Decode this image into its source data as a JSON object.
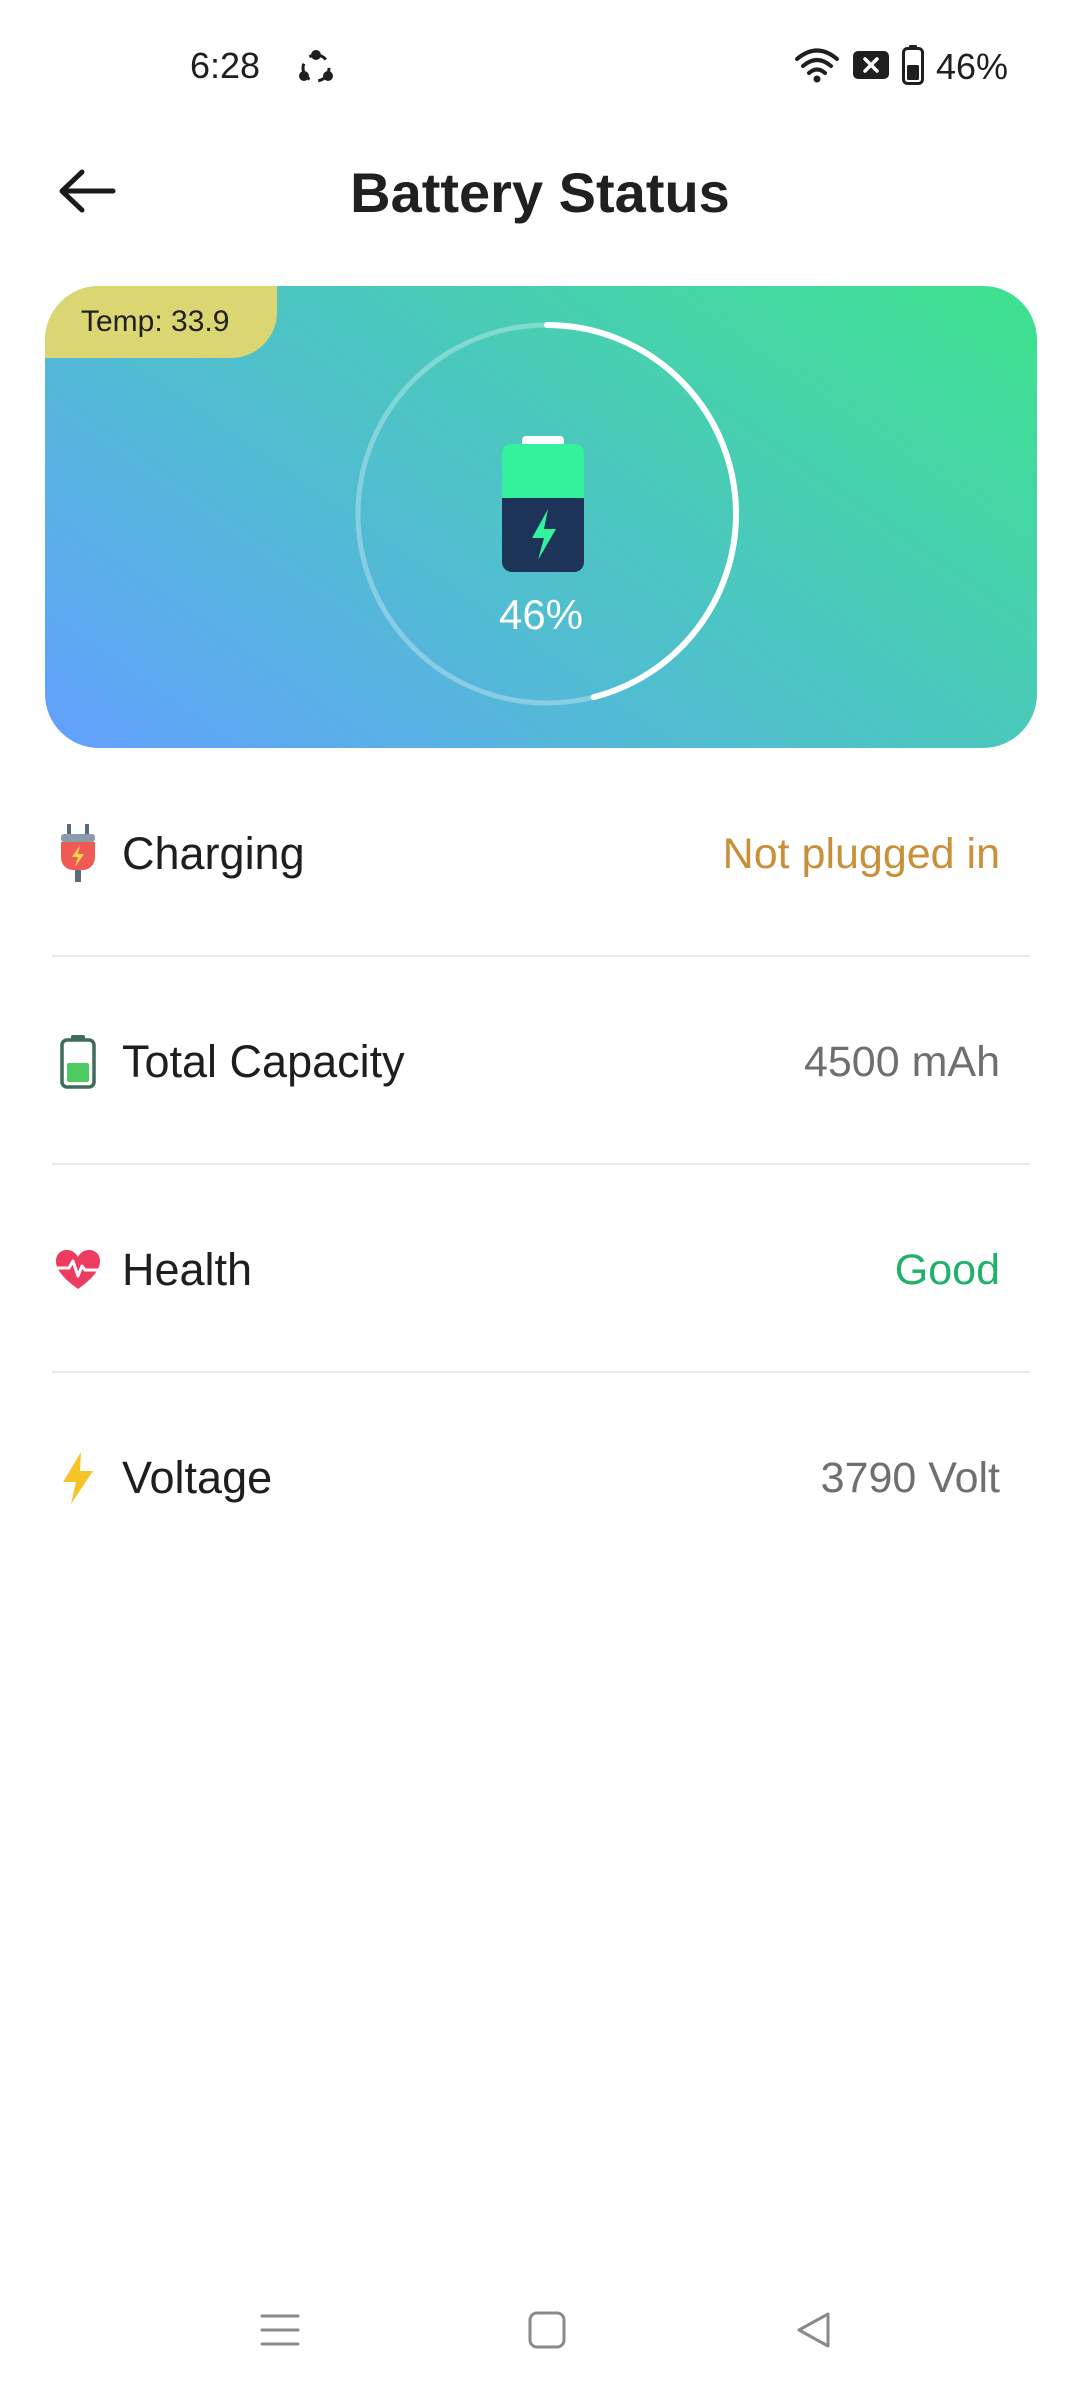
{
  "status_bar": {
    "time": "6:28",
    "battery_percent": "46%",
    "icons": [
      "sync-app-icon",
      "wifi-icon",
      "sim-off-icon",
      "battery-icon"
    ]
  },
  "header": {
    "title": "Battery Status",
    "back_icon": "back-arrow-icon"
  },
  "hero": {
    "temp_label": "Temp: 33.9",
    "battery_level_text": "46%",
    "battery_level_fraction": 0.46,
    "colors": {
      "gradient_start": "#63a0ff",
      "gradient_end": "#3ee38d",
      "badge": "#dcd672",
      "ring": "#ffffff"
    }
  },
  "rows": [
    {
      "icon": "plug-icon",
      "label": "Charging",
      "value": "Not plugged in",
      "value_color": "#c9903a"
    },
    {
      "icon": "battery-capacity-icon",
      "label": "Total Capacity",
      "value": "4500 mAh",
      "value_color": "#6f6f6f"
    },
    {
      "icon": "heart-pulse-icon",
      "label": "Health",
      "value": "Good",
      "value_color": "#1fb26b"
    },
    {
      "icon": "lightning-icon",
      "label": "Voltage",
      "value": "3790 Volt",
      "value_color": "#6f6f6f"
    }
  ],
  "nav_bar": {
    "icons": [
      "menu-icon",
      "home-icon",
      "back-triangle-icon"
    ]
  }
}
